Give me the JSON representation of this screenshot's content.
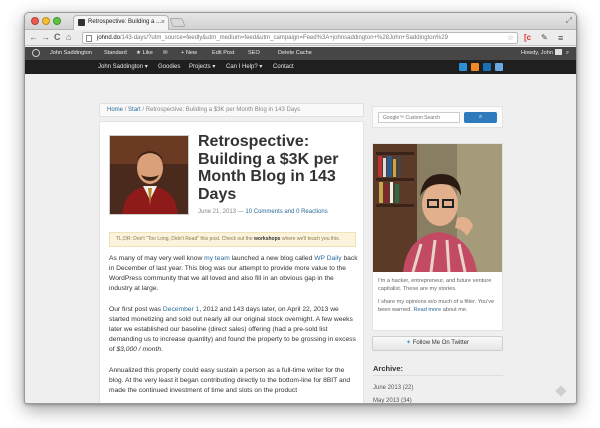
{
  "browser": {
    "tab_title": "Retrospective: Building a ...",
    "tab_close": "×",
    "url_host": "johnd.do",
    "url_path": "/143-days/?utm_source=feedly&utm_medium=feed&utm_campaign=Feed%3A+johnsaddington+%28John+Saddington%29",
    "nav": {
      "back": "←",
      "forward": "→",
      "reload": "C",
      "home": "⌂"
    },
    "menu_icon": "≡",
    "ext_c": "[c",
    "ext_wrench": "✎"
  },
  "admin_bar": {
    "site_name": "John Saddington",
    "standard": "Standard",
    "like": "★ Like",
    "comments_icon": "✉",
    "new": "+ New",
    "edit_post": "Edit Post",
    "seo": "SEO",
    "delete_cache": "Delete Cache",
    "howdy": "Howdy, John",
    "search_icon": "⌕"
  },
  "site_nav": {
    "items": [
      "John Saddington ▾",
      "Goodies",
      "Projects ▾",
      "Can I Help? ▾",
      "Contact"
    ],
    "social_colors": [
      "#2f8fd6",
      "#f08a24",
      "#1a6fb3",
      "#6aa9e0"
    ]
  },
  "breadcrumb": {
    "home": "Home",
    "start": "Start",
    "sep": "/",
    "current": "Retrospective: Building a $3K per Month Blog in 143 Days"
  },
  "article": {
    "title": "Retrospective: Building a $3K per Month Blog in 143 Days",
    "date": "June 21, 2013",
    "dash": "—",
    "comments_link": "10 Comments and 0 Reactions",
    "tldr_prefix": "TL;DR: Don't \"Too Long, Didn't Read\" this post. Check out the",
    "tldr_link": "workshops",
    "tldr_suffix": "where we'll teach you this.",
    "p1_a": "As many of may very well know",
    "p1_link1": "my team",
    "p1_b": "launched a new blog called",
    "p1_link2": "WP Daily",
    "p1_c": "back in December of last year. This blog was our attempt to provide more value to the WordPress community that we all loved and also fill in an obvious gap in the industry at large.",
    "p2_a": "Our first post was",
    "p2_link": "December 1",
    "p2_b": ", 2012 and 143 days later, on April 22, 2013 we started monetizing and sold out nearly all our original stock overnight. A few weeks later we established our baseline (direct sales) offering (had a pre-sold list demanding us to increase quantity) and found the property to be grossing in excess of",
    "p2_em": "$3,000 / month",
    "p2_c": ".",
    "p3": "Annualized this property could easy sustain a person as a full-time writer for the blog. At the very least it began contributing directly to the bottom-line for 8BIT and made the continued investment of time and slots on the product"
  },
  "sidebar": {
    "search_placeholder": "Google™ Custom Search",
    "search_button": "⌕",
    "bio1": "I'm a hacker, entrepreneur, and future venture capitalist. These are my stories.",
    "bio2_a": "I share my opinions w/o much of a filter. You've been warned.",
    "bio2_link": "Read more",
    "bio2_b": "about me.",
    "follow": "Follow Me On Twitter",
    "follow_icon": "✦",
    "archive_heading": "Archive:",
    "archive": [
      {
        "month": "June 2013",
        "count": "(22)"
      },
      {
        "month": "May 2013",
        "count": "(34)"
      }
    ]
  },
  "colors": {
    "link": "#2b6b9a",
    "adminbar": "#464646",
    "sitenav": "#1f1f1f",
    "search_button": "#2f79bd"
  }
}
